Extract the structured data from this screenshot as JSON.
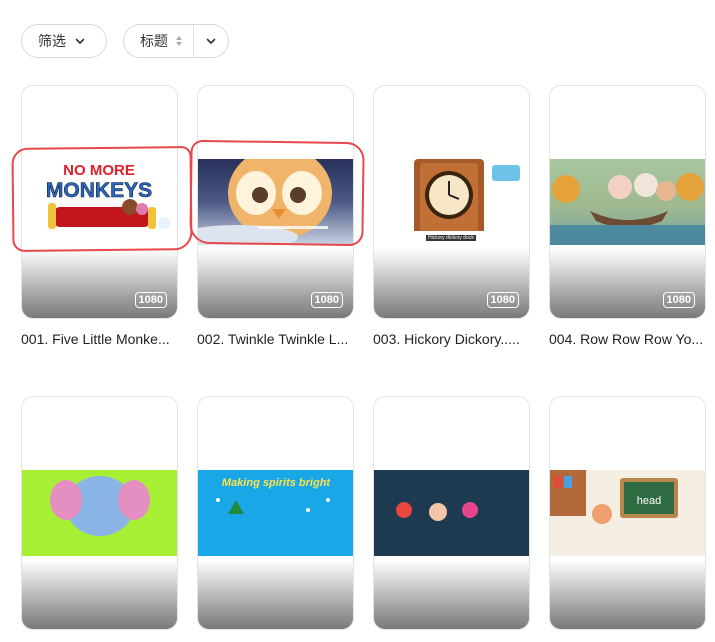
{
  "toolbar": {
    "filter_label": "筛选",
    "sort_label": "标题"
  },
  "videos": [
    {
      "title": "001. Five Little Monke...",
      "resolution": "1080",
      "art_text_1": "NO MORE",
      "art_text_2": "MONKEYS"
    },
    {
      "title": "002. Twinkle Twinkle L...",
      "resolution": "1080"
    },
    {
      "title": "003. Hickory Dickory.....",
      "resolution": "1080",
      "subtitle": "Hickory dickory dock"
    },
    {
      "title": "004. Row Row Row Yo...",
      "resolution": "1080"
    },
    {
      "title": "",
      "resolution": ""
    },
    {
      "title": "",
      "resolution": "",
      "art_text_1": "Making spirits bright"
    },
    {
      "title": "",
      "resolution": ""
    },
    {
      "title": "",
      "resolution": "",
      "art_text_1": "head"
    }
  ]
}
